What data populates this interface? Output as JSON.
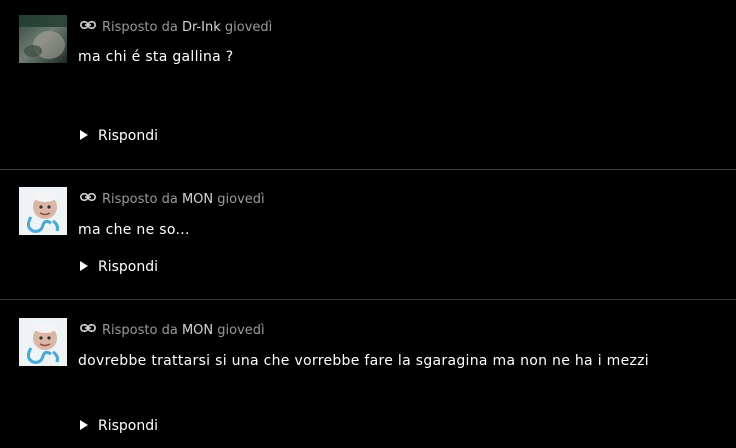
{
  "comments": [
    {
      "replied_by_label": "Risposto da",
      "author": "Dr-Ink",
      "day": "giovedì",
      "text": "ma chi é sta gallina ?",
      "reply_label": "Rispondi"
    },
    {
      "replied_by_label": "Risposto da",
      "author": "MON",
      "day": "giovedì",
      "text": "ma che ne so...",
      "reply_label": "Rispondi"
    },
    {
      "replied_by_label": "Risposto da",
      "author": "MON",
      "day": "giovedì",
      "text": "dovrebbe trattarsi si una che vorrebbe fare la sgaragina ma non ne ha i mezzi",
      "reply_label": "Rispondi"
    }
  ],
  "colors": {
    "background": "#000000",
    "meta_text": "#9a9a9a",
    "author_text": "#d6d6d6",
    "body_text": "#ffffff",
    "divider": "#3a3a3a"
  },
  "icons": {
    "permalink": "link-icon",
    "reply": "play-triangle-icon"
  }
}
